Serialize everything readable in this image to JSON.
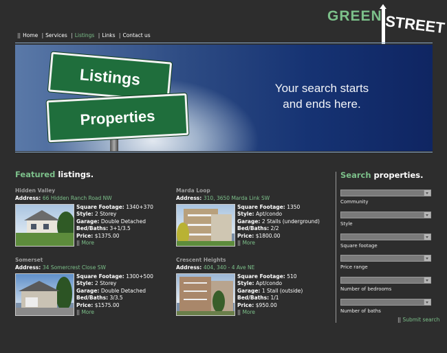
{
  "logo": {
    "word1": "GREEN",
    "word2": "STREET"
  },
  "nav": {
    "items": [
      {
        "label": "Home",
        "active": false
      },
      {
        "label": "Services",
        "active": false
      },
      {
        "label": "Listings",
        "active": true
      },
      {
        "label": "Links",
        "active": false
      },
      {
        "label": "Contact us",
        "active": false
      }
    ]
  },
  "banner": {
    "sign_top": "Listings",
    "sign_bottom": "Properties",
    "tagline_line1": "Your search starts",
    "tagline_line2": "and ends here."
  },
  "featured": {
    "title_accent": "Featured",
    "title_rest": " listings.",
    "address_label": "Address:",
    "more_label": "More",
    "listings": [
      {
        "area": "Hidden Valley",
        "address": "66 Hidden Ranch Road NW",
        "sqft": "1340+370",
        "style": "2 Storey",
        "garage": "Double Detached",
        "bedbath": "3+1/3.5",
        "price": "$1375.00"
      },
      {
        "area": "Marda Loop",
        "address": "310, 3650 Marda Link SW",
        "sqft": "1350",
        "style": "Apt/condo",
        "garage": "2 Stalls (underground)",
        "bedbath": "2/2",
        "price": "$1800.00"
      },
      {
        "area": "Somerset",
        "address": "34 Somercrest Close SW",
        "sqft": "1300+500",
        "style": "2 Storey",
        "garage": "Double Detached",
        "bedbath": "3/3.5",
        "price": "$1575.00"
      },
      {
        "area": "Crescent Heights",
        "address": "404, 340 - 4 Ave NE",
        "sqft": "510",
        "style": "Apt/condo",
        "garage": "1 Stall (outside)",
        "bedbath": "1/1",
        "price": "$950.00"
      }
    ],
    "labels": {
      "sqft": "Square Footage:",
      "style": "Style:",
      "garage": "Garage:",
      "bedbath": "Bed/Baths:",
      "price": "Price:"
    }
  },
  "search": {
    "title_accent": "Search",
    "title_rest": " properties.",
    "fields": [
      {
        "label": "Community"
      },
      {
        "label": "Style"
      },
      {
        "label": "Square footage"
      },
      {
        "label": "Price range"
      },
      {
        "label": "Number of bedrooms"
      },
      {
        "label": "Number of baths"
      }
    ],
    "submit_label": "Submit search"
  },
  "colors": {
    "accent": "#7cc08a",
    "background": "#2d2d2d"
  }
}
